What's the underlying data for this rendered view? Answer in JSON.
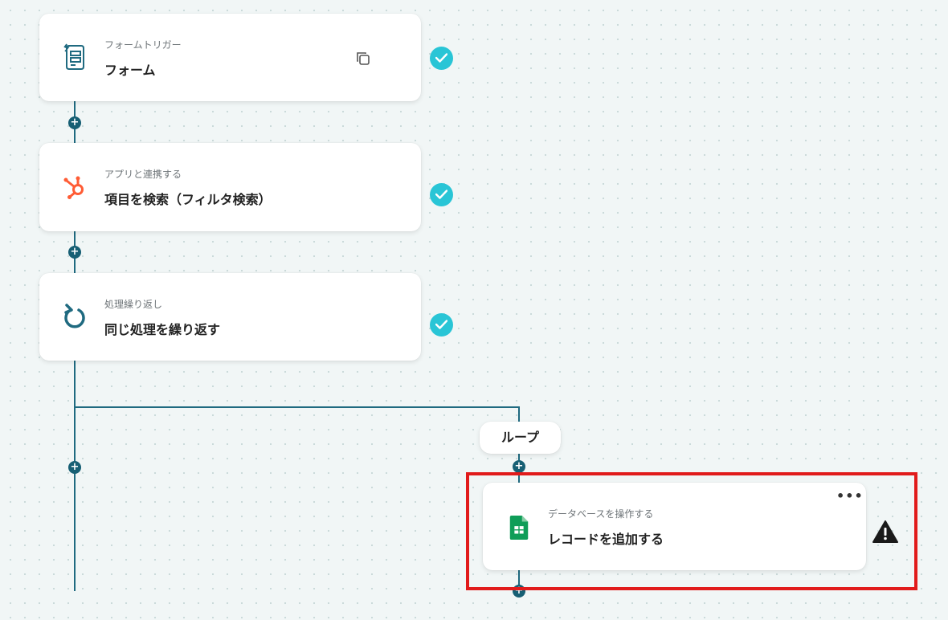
{
  "flow": {
    "steps": [
      {
        "type_label": "フォームトリガー",
        "title": "フォーム",
        "icon": "form-icon",
        "status": "completed"
      },
      {
        "type_label": "アプリと連携する",
        "title": "項目を検索（フィルタ検索）",
        "icon": "hubspot-icon",
        "status": "completed"
      },
      {
        "type_label": "処理繰り返し",
        "title": "同じ処理を繰り返す",
        "icon": "loop-icon",
        "status": "completed"
      }
    ],
    "loop": {
      "label": "ループ",
      "step": {
        "type_label": "データベースを操作する",
        "title": "レコードを追加する",
        "icon": "google-sheets-icon",
        "status": "warning"
      }
    },
    "add_button_symbol": "+",
    "more_symbol": "•••"
  },
  "colors": {
    "connector": "#1f6a80",
    "check": "#29c5d6",
    "highlight": "#e11b1b",
    "hubspot": "#ff5c35",
    "sheets": "#0f9d58"
  }
}
